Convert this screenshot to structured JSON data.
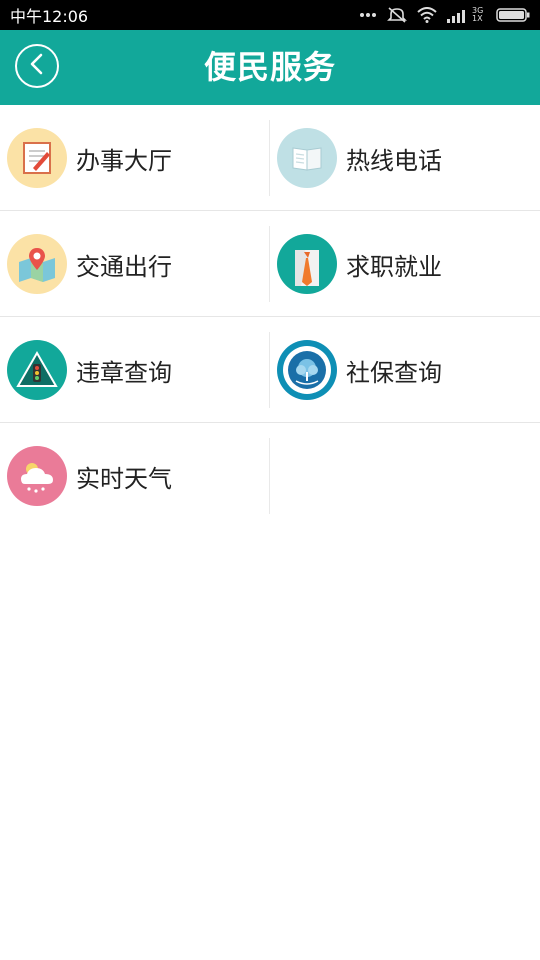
{
  "status_bar": {
    "time": "中午12:06",
    "network": "3G 1X",
    "icons": [
      "more-dots-icon",
      "mute-icon",
      "wifi-icon",
      "signal-icon",
      "battery-icon"
    ]
  },
  "header": {
    "title": "便民服务",
    "back_icon": "chevron-left-icon",
    "background": "#12A89A"
  },
  "services": [
    {
      "label": "办事大厅",
      "icon": "notepad-icon",
      "icon_bg": "#FBE2A6"
    },
    {
      "label": "热线电话",
      "icon": "book-icon",
      "icon_bg": "#BFE0E5"
    },
    {
      "label": "交通出行",
      "icon": "map-pin-icon",
      "icon_bg": "#FBE2A6"
    },
    {
      "label": "求职就业",
      "icon": "suit-tie-icon",
      "icon_bg": "#12A89A"
    },
    {
      "label": "违章查询",
      "icon": "traffic-light-icon",
      "icon_bg": "#12A89A"
    },
    {
      "label": "社保查询",
      "icon": "social-security-emblem-icon",
      "icon_bg": "#0E8FB5"
    },
    {
      "label": "实时天气",
      "icon": "weather-cloud-icon",
      "icon_bg": "#EA7B98"
    }
  ]
}
